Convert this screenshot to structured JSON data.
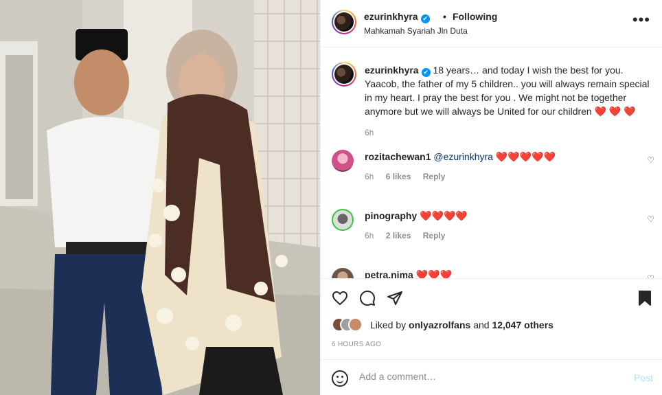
{
  "header": {
    "username": "ezurinkhyra",
    "verified_mark": "✔",
    "separator": "•",
    "follow_status": "Following",
    "location": "Mahkamah Syariah Jln Duta",
    "more_icon": "more-horizontal-icon"
  },
  "caption": {
    "username": "ezurinkhyra",
    "text": "18 years… and today I wish the best for you. Yaacob, the father of my 5 children.. you will always remain special in my heart. I pray the best for you . We might not be together anymore but we will always be United for our children",
    "emojis": "❤️ ❤️ ❤️",
    "time": "6h"
  },
  "comments": [
    {
      "username": "rozitachewan1",
      "mention": "@ezurinkhyra",
      "emojis": "❤️❤️❤️❤️❤️",
      "time": "6h",
      "likes": "6 likes",
      "reply": "Reply"
    },
    {
      "username": "pinography",
      "mention": "",
      "emojis": "❤️❤️❤️❤️",
      "time": "6h",
      "likes": "2 likes",
      "reply": "Reply"
    },
    {
      "username": "petra.nima",
      "mention": "",
      "emojis": "❤️❤️❤️",
      "time": "",
      "likes": "",
      "reply": ""
    }
  ],
  "actions": {
    "liked_prefix": "Liked by",
    "liked_user": "onlyazrolfans",
    "liked_and": "and",
    "liked_others": "12,047 others",
    "timestamp": "6 HOURS AGO"
  },
  "add_comment": {
    "placeholder": "Add a comment…",
    "post_label": "Post"
  },
  "colors": {
    "verified": "#0095f6",
    "post_disabled": "#b2dffc",
    "heart": "#ed1c24"
  }
}
